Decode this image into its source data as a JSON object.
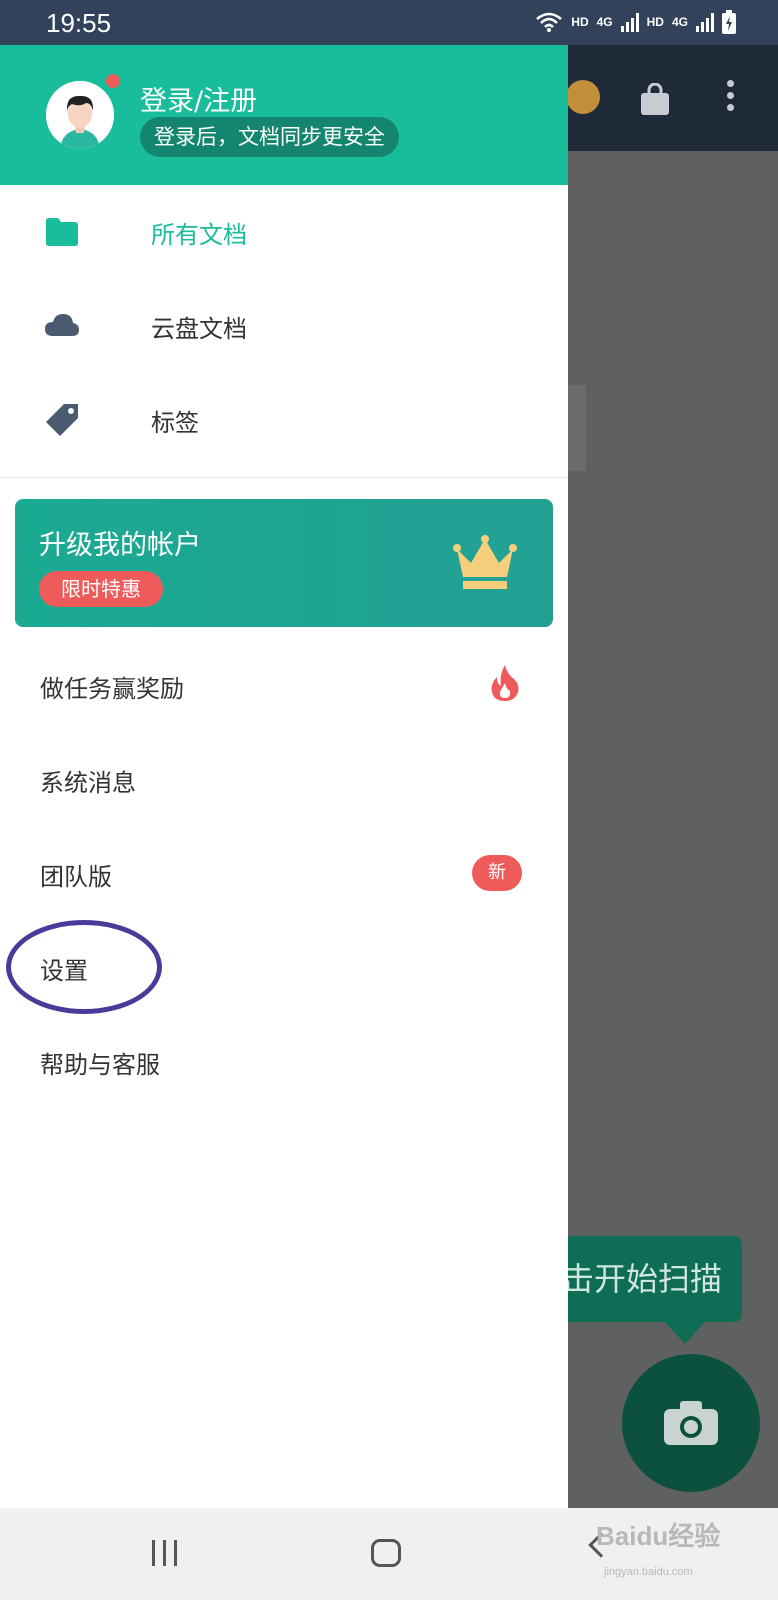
{
  "status_bar": {
    "time": "19:55",
    "hd1": "HD",
    "net1": "4G",
    "hd2": "HD",
    "net2": "4G"
  },
  "background": {
    "scan_tip": "击开始扫描"
  },
  "drawer": {
    "login_title": "登录/注册",
    "login_subtitle": "登录后，文档同步更安全",
    "nav": [
      {
        "label": "所有文档",
        "icon": "folder-icon",
        "active": true
      },
      {
        "label": "云盘文档",
        "icon": "cloud-icon",
        "active": false
      },
      {
        "label": "标签",
        "icon": "tag-icon",
        "active": false
      }
    ],
    "upgrade": {
      "title": "升级我的帐户",
      "badge": "限时特惠",
      "icon": "crown-icon"
    },
    "menu": [
      {
        "label": "做任务赢奖励",
        "icon": "fire-icon"
      },
      {
        "label": "系统消息"
      },
      {
        "label": "团队版",
        "badge": "新"
      },
      {
        "label": "设置"
      },
      {
        "label": "帮助与客服"
      }
    ]
  },
  "watermark": {
    "text": "Baidu经验",
    "sub": "jingyan.baidu.com"
  },
  "colors": {
    "brand": "#19bc9b",
    "badge": "#ef5b5b",
    "header_dark": "#33425b",
    "annotation": "#4a3a9a"
  }
}
